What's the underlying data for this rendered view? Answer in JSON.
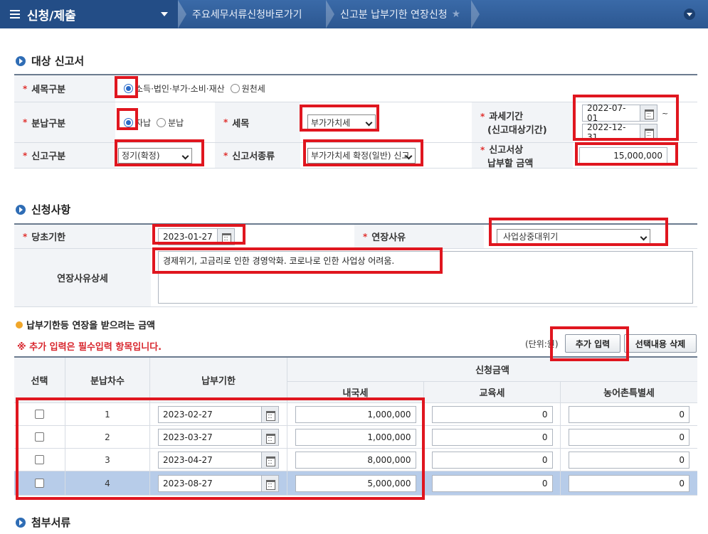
{
  "topbar": {
    "menu_title": "신청/제출",
    "crumb1": "주요세무서류신청바로가기",
    "crumb2": "신고분 납부기한 연장신청",
    "star": "★"
  },
  "section1": {
    "title": "대상 신고서",
    "tax_item_label": "세목구분",
    "tax_item_options": [
      "소득·법인·부가·소비·재산",
      "원천세"
    ],
    "payment_type_label": "분납구분",
    "payment_type_options": [
      "자납",
      "분납"
    ],
    "tax_label": "세목",
    "tax_value": "부가가치세",
    "period_label_1": "과세기간",
    "period_label_2": "(신고대상기간)",
    "period_from": "2022-07-01",
    "period_tilde": "~",
    "period_to": "2022-12-31",
    "report_type_label": "신고구분",
    "report_type_value": "정기(확정)",
    "report_kind_label": "신고서종류",
    "report_kind_value": "부가가치세 확정(일반) 신고",
    "amount_label_1": "신고서상",
    "amount_label_2": "납부할 금액",
    "amount_value": "15,000,000"
  },
  "section2": {
    "title": "신청사항",
    "due_label": "당초기한",
    "due_value": "2023-01-27",
    "reason_label": "연장사유",
    "reason_value": "사업상중대위기",
    "detail_label": "연장사유상세",
    "detail_value": "경제위기, 고금리로 인한 경영악화. 코로나로 인한 사업상 어려움."
  },
  "section3": {
    "subtitle": "납부기한등 연장을 받으려는 금액",
    "notice": "※ 추가 입력은 필수입력 항목입니다.",
    "unit": "(단위:원)",
    "add_button": "추가 입력",
    "delete_button": "선택내용 삭제",
    "headers": {
      "select": "선택",
      "round": "분납차수",
      "deadline": "납부기한",
      "amount_group": "신청금액",
      "national": "내국세",
      "education": "교육세",
      "rural": "농어촌특별세"
    },
    "rows": [
      {
        "round": "1",
        "deadline": "2023-02-27",
        "national": "1,000,000",
        "education": "0",
        "rural": "0"
      },
      {
        "round": "2",
        "deadline": "2023-03-27",
        "national": "1,000,000",
        "education": "0",
        "rural": "0"
      },
      {
        "round": "3",
        "deadline": "2023-04-27",
        "national": "8,000,000",
        "education": "0",
        "rural": "0"
      },
      {
        "round": "4",
        "deadline": "2023-08-27",
        "national": "5,000,000",
        "education": "0",
        "rural": "0"
      }
    ]
  },
  "section4": {
    "title": "첨부서류"
  },
  "colors": {
    "topbar": "#2c5791",
    "highlight": "#e0161f",
    "required": "#e0312f",
    "selected_row": "#b7cce9"
  }
}
